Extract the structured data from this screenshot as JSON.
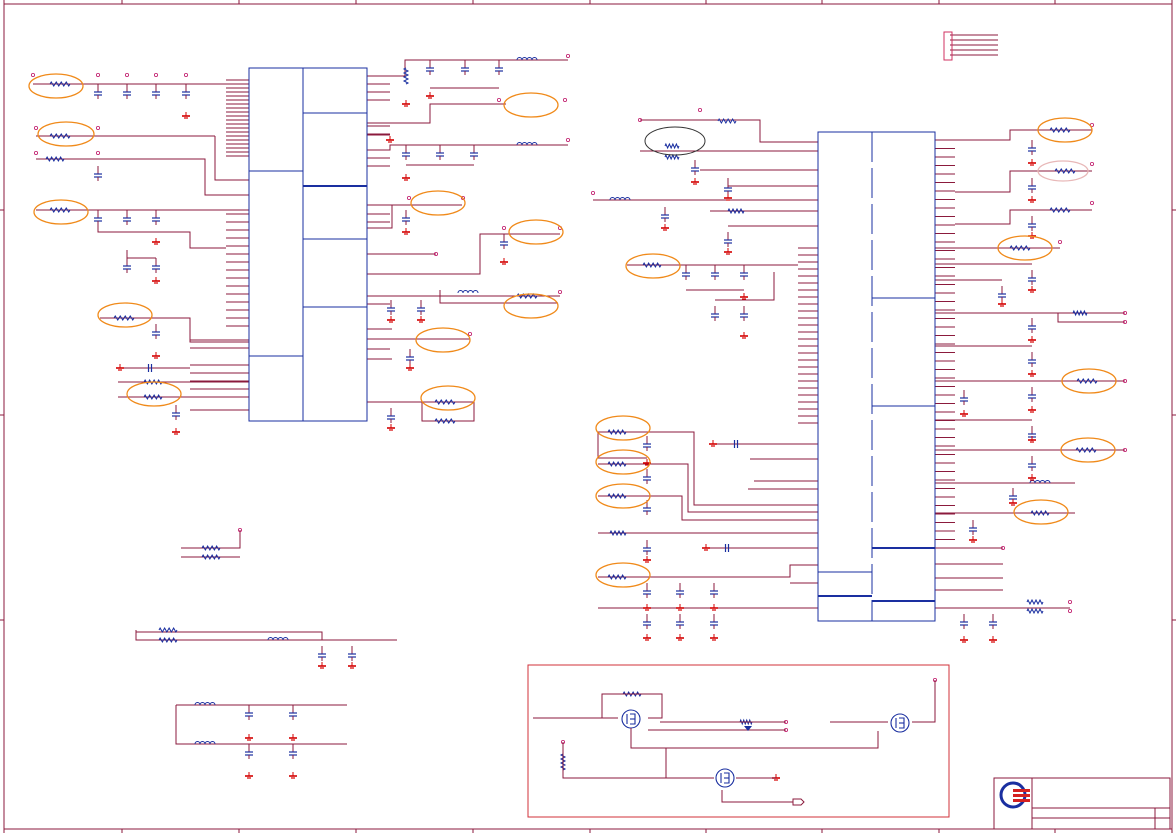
{
  "sheet": {
    "title": "",
    "colors": {
      "wire": "#8b1a3c",
      "component": "#1a2fa0",
      "ground": "#d40000",
      "highlight": "#f08a1a",
      "frame": "#8b1a3c",
      "pin": "#c0186a",
      "chip_outline": "#1a2fa0",
      "callout_box": "#d0303a"
    },
    "grid_columns": 10,
    "grid_rows": 4
  },
  "components": {
    "left_chip": "ic",
    "right_chip": "ic",
    "power_section": "mosfet-switch-block",
    "logo": "company-logo-icon"
  },
  "annotations": {
    "highlight_ellipse_count": 24
  }
}
